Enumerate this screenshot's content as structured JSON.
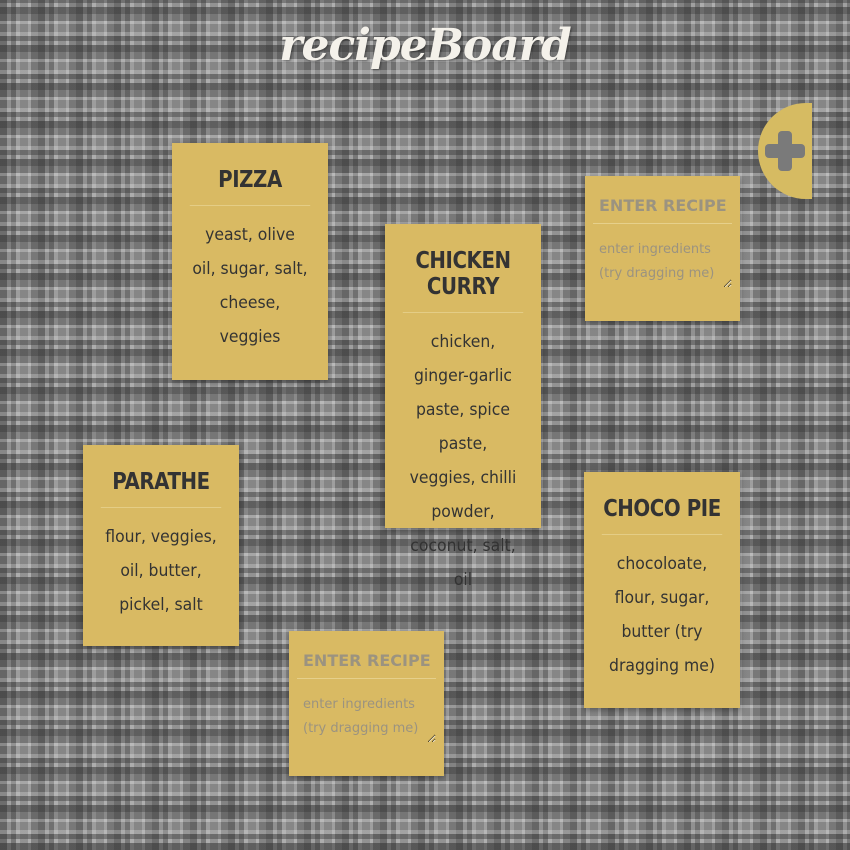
{
  "app": {
    "title": "recipeBoard"
  },
  "add_button": {
    "icon": "plus-icon"
  },
  "recipes": [
    {
      "name": "PIZZA",
      "ingredients": "yeast, olive oil, sugar, salt, cheese, veggies"
    },
    {
      "name": "CHICKEN CURRY",
      "ingredients": "chicken, ginger-garlic paste, spice paste, veggies, chilli powder, coconut, salt, oil"
    },
    {
      "name": "PARATHE",
      "ingredients": "flour, veggies, oil, butter, pickel, salt"
    },
    {
      "name": "CHOCO PIE",
      "ingredients": "chocoloate, flour, sugar, butter (try dragging me)"
    }
  ],
  "new_cards": [
    {
      "name_placeholder": "ENTER RECIPE NAME",
      "ingredients_placeholder": "enter ingredients (try dragging me)"
    },
    {
      "name_placeholder": "ENTER RECIPE NAME",
      "ingredients_placeholder": "enter ingredients (try dragging me)"
    }
  ],
  "colors": {
    "card": "#d9ba63",
    "add_button": "#d6bb62",
    "text": "#333333"
  }
}
